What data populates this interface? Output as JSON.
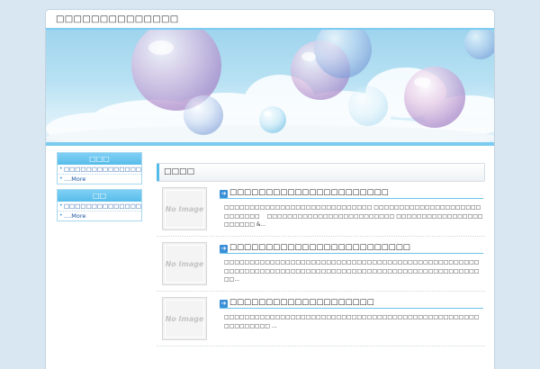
{
  "site": {
    "title": "□□□□□□□□□□□□□□"
  },
  "header": {
    "image": "bubbles-sky-banner"
  },
  "sidebar": {
    "widgets": [
      {
        "title": "□□□",
        "items": [
          {
            "label": "□□□□□□□□□□□□□□□□□□□□□□□□"
          },
          {
            "label": "....More"
          }
        ]
      },
      {
        "title": "□□",
        "items": [
          {
            "label": "□□□□□□□□□□□□□□□□□□□□"
          },
          {
            "label": "....More"
          }
        ]
      }
    ]
  },
  "main": {
    "section_title": "□□□□",
    "posts": [
      {
        "thumb": "No Image",
        "title": "□□□□□□□□□□□□□□□□□□□□□□",
        "excerpt": "□□□□□□□□□□□□□□□□□□□□□□□□□□□□□ □□□□□□□□□□□□□□□□□□□□□□□□□□□□ 　□□□□□□□□□□□□□□□□□□□□□□□□□ □□□□□□□□□□□□□□□□□□□□□□□ &..."
      },
      {
        "thumb": "No Image",
        "title": "□□□□□□□□□□□□□□□□□□□□□□□□□",
        "excerpt": "□□□□□□□□□□□□□□□□□□□□□□□□□□□□□□□□□□□□□□□□□□□□□□□□□□□□□□□□□□□□□□□□□□□□□□□□□□□□□□□□□□□□□□□□□□□□□□□□□□□□□□..."
      },
      {
        "thumb": "No Image",
        "title": "□□□□□□□□□□□□□□□□□□□□",
        "excerpt": "□□□□□□□□□□□□□□□□□□□□□□□□□□□□□□□□□□□□□□□□□□□□□□□□□□□□□□□□□□□ ..."
      }
    ]
  },
  "colors": {
    "accent": "#58bdea",
    "link": "#1a55a3",
    "background": "#d9e7f2"
  }
}
